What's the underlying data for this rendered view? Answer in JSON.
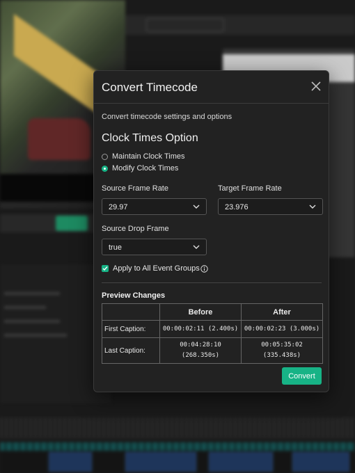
{
  "dialog": {
    "title": "Convert Timecode",
    "subtitle": "Convert timecode settings and options",
    "section_title": "Clock Times Option",
    "clock_options": [
      {
        "label": "Maintain Clock Times",
        "selected": false
      },
      {
        "label": "Modify Clock Times",
        "selected": true
      }
    ],
    "source_frame_rate": {
      "label": "Source Frame Rate",
      "value": "29.97"
    },
    "target_frame_rate": {
      "label": "Target Frame Rate",
      "value": "23.976"
    },
    "source_drop_frame": {
      "label": "Source Drop Frame",
      "value": "true"
    },
    "apply_all": {
      "label": "Apply to All Event Groups",
      "checked": true
    },
    "preview": {
      "title": "Preview Changes",
      "headers": [
        "",
        "Before",
        "After"
      ],
      "rows": [
        {
          "label": "First Caption:",
          "before": "00:00:02:11 (2.400s)",
          "after": "00:00:02:23 (3.000s)"
        },
        {
          "label": "Last Caption:",
          "before_line1": "00:04:28:10",
          "before_line2": "(268.350s)",
          "after_line1": "00:05:35:02",
          "after_line2": "(335.438s)"
        }
      ]
    },
    "convert_label": "Convert"
  },
  "colors": {
    "accent": "#17b386",
    "dialog_bg": "#222222",
    "border": "#3a3a3a"
  },
  "icons": {
    "close": "close-icon",
    "chevron": "chevron-down-icon",
    "info": "info-icon",
    "check": "check-icon"
  }
}
